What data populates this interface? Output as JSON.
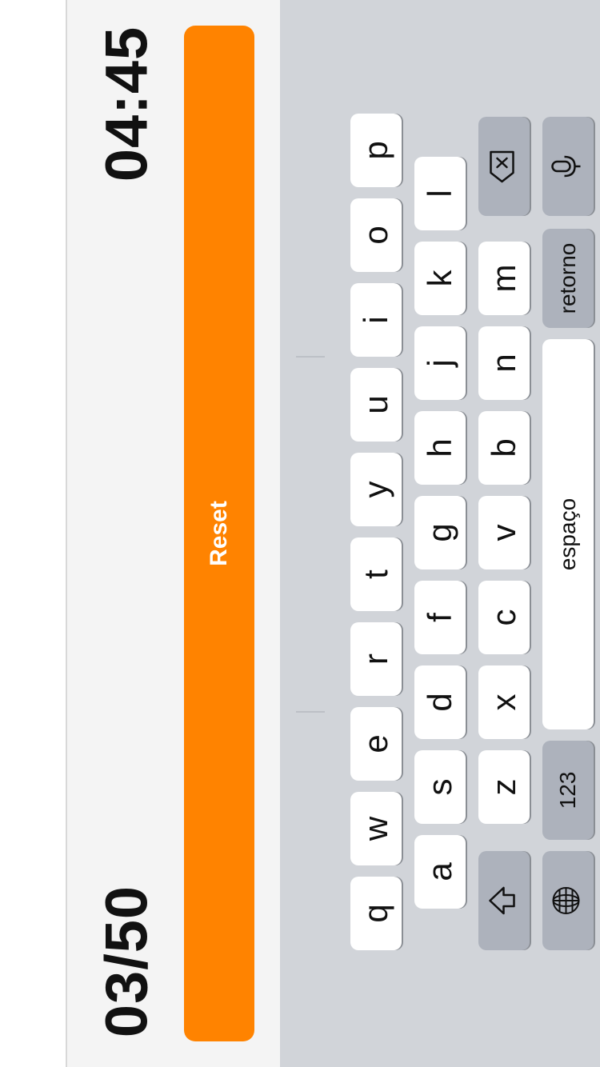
{
  "counter": {
    "text": "03/50"
  },
  "timer": {
    "text": "04:45"
  },
  "reset": {
    "label": "Reset"
  },
  "colors": {
    "accent": "#ff8300",
    "keyboard_bg": "#d1d4d9",
    "panel_bg": "#f4f4f4"
  },
  "keyboard": {
    "row1": [
      "q",
      "w",
      "e",
      "r",
      "t",
      "y",
      "u",
      "i",
      "o",
      "p"
    ],
    "row2": [
      "a",
      "s",
      "d",
      "f",
      "g",
      "h",
      "j",
      "k",
      "l"
    ],
    "row3": [
      "z",
      "x",
      "c",
      "v",
      "b",
      "n",
      "m"
    ],
    "numbers_label": "123",
    "space_label": "espaço",
    "return_label": "retorno",
    "icons": {
      "shift": "shift-icon",
      "delete": "delete-icon",
      "globe": "globe-icon",
      "mic": "microphone-icon"
    }
  }
}
